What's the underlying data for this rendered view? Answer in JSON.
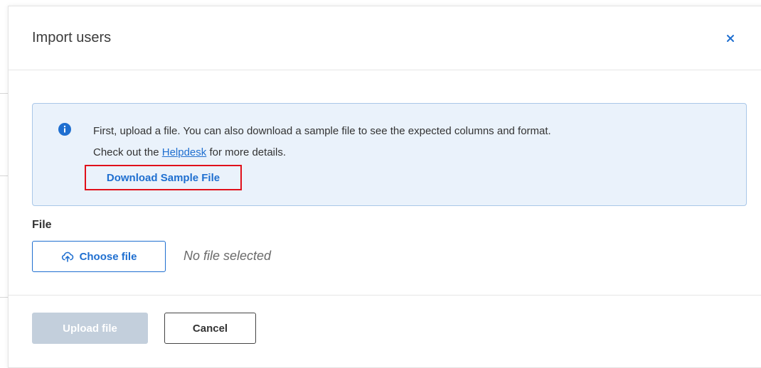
{
  "modal": {
    "title": "Import users",
    "close_icon": "close-icon"
  },
  "info": {
    "icon": "info-icon",
    "line1": "First, upload a file. You can also download a sample file to see the expected columns and format.",
    "line2_prefix": "Check out the ",
    "line2_link": "Helpdesk",
    "line2_suffix": " for more details.",
    "download_label": "Download Sample File"
  },
  "file": {
    "label": "File",
    "choose_label": "Choose file",
    "choose_icon": "cloud-upload-icon",
    "status": "No file selected"
  },
  "footer": {
    "upload_label": "Upload file",
    "cancel_label": "Cancel"
  },
  "colors": {
    "accent": "#1f6fd0",
    "info_bg": "#eaf2fb",
    "info_border": "#a9c7e8",
    "highlight": "#e0101a",
    "disabled": "#c3cfdc"
  }
}
